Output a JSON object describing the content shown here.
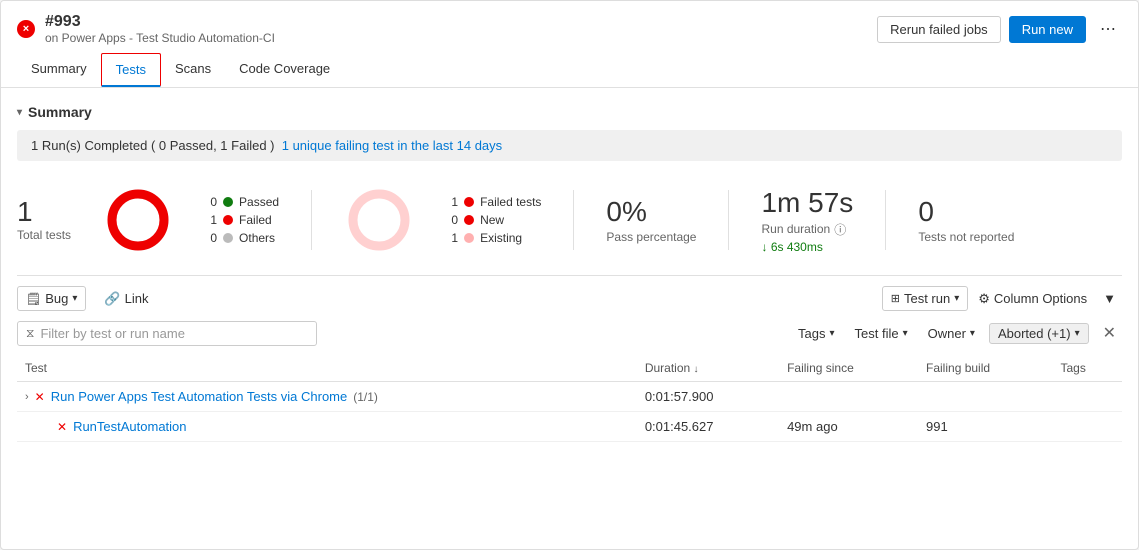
{
  "header": {
    "close_icon": "×",
    "build_number": "#993",
    "build_subtitle": "on Power Apps - Test Studio Automation-CI",
    "btn_rerun": "Rerun failed jobs",
    "btn_run_new": "Run new",
    "more_icon": "⋯"
  },
  "nav": {
    "tabs": [
      "Summary",
      "Tests",
      "Scans",
      "Code Coverage"
    ],
    "active_tab": "Tests"
  },
  "summary": {
    "section_title": "Summary",
    "banner_text": "1 Run(s) Completed ( 0 Passed, 1 Failed )",
    "banner_link": "1 unique failing test in the last 14 days",
    "total_tests_num": "1",
    "total_tests_label": "Total tests",
    "legend": [
      {
        "count": "0",
        "label": "Passed",
        "color": "#107c10"
      },
      {
        "count": "1",
        "label": "Failed",
        "color": "#e00"
      },
      {
        "count": "0",
        "label": "Others",
        "color": "#bbb"
      }
    ],
    "failed_stats": [
      {
        "count": "1",
        "label": "Failed tests",
        "color": "#e00"
      },
      {
        "count": "0",
        "label": "New",
        "color": "#e00"
      },
      {
        "count": "1",
        "label": "Existing",
        "color": "#f9a"
      }
    ],
    "pass_pct": "0%",
    "pass_pct_label": "Pass percentage",
    "run_duration": "1m 57s",
    "run_duration_label": "Run duration",
    "run_duration_sub": "↓ 6s 430ms",
    "not_reported": "0",
    "not_reported_label": "Tests not reported"
  },
  "table": {
    "toolbar": {
      "bug_label": "Bug",
      "link_label": "Link",
      "test_run_label": "Test run",
      "column_options_label": "Column Options",
      "filter_icon": "▼"
    },
    "filter": {
      "placeholder": "Filter by test or run name",
      "tags_label": "Tags",
      "test_file_label": "Test file",
      "owner_label": "Owner",
      "aborted_label": "Aborted (+1)"
    },
    "columns": [
      {
        "label": "Test",
        "sortable": false
      },
      {
        "label": "Duration",
        "sortable": true
      },
      {
        "label": "Failing since",
        "sortable": false
      },
      {
        "label": "Failing build",
        "sortable": false
      },
      {
        "label": "Tags",
        "sortable": false
      }
    ],
    "rows": [
      {
        "id": "row-1",
        "type": "group",
        "expand": "›",
        "fail_icon": "✕",
        "name": "Run Power Apps Test Automation Tests via Chrome",
        "count": "(1/1)",
        "duration": "0:01:57.900",
        "failing_since": "",
        "failing_build": "",
        "tags": ""
      },
      {
        "id": "row-2",
        "type": "child",
        "fail_icon": "✕",
        "name": "RunTestAutomation",
        "count": "",
        "duration": "0:01:45.627",
        "failing_since": "49m ago",
        "failing_build": "991",
        "tags": ""
      }
    ]
  }
}
